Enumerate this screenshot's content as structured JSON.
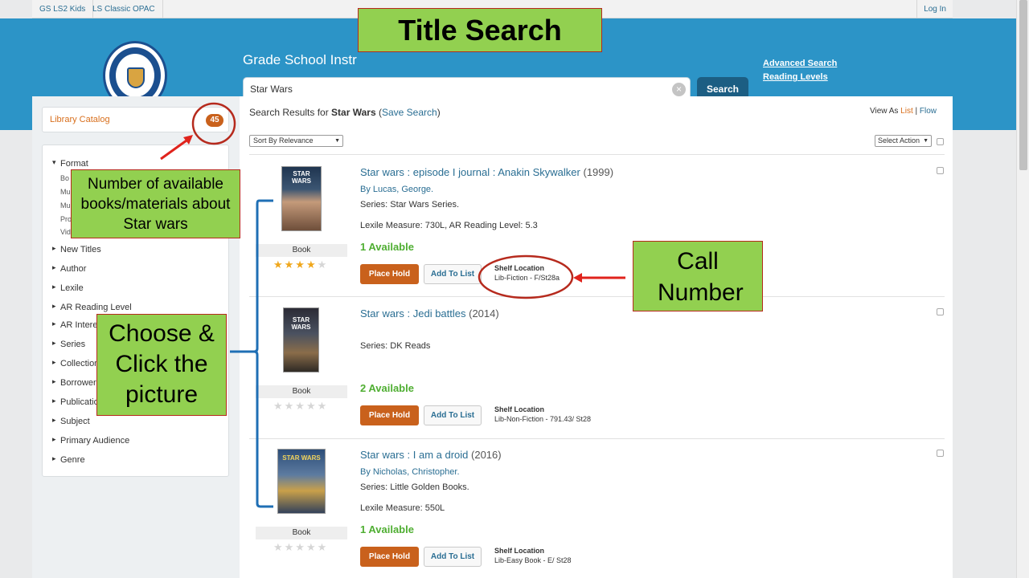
{
  "topbar": {
    "links": [
      "GS LS2 Kids",
      "LS Classic OPAC"
    ],
    "login": "Log In"
  },
  "header": {
    "site_title": "Grade School Instr",
    "search_value": "Star Wars",
    "search_button": "Search",
    "advanced_search": "Advanced Search",
    "reading_levels": "Reading Levels"
  },
  "sidebar": {
    "catalog_label": "Library Catalog",
    "catalog_count": "45",
    "format": "Format",
    "format_items": [
      "Bo",
      "Mu",
      "Mu",
      "Pro",
      "Vid"
    ],
    "facets": [
      "New Titles",
      "Author",
      "Lexile",
      "AR Reading Level",
      "AR Intere",
      "Series",
      "Collection",
      "Borrower",
      "Publication",
      "Subject",
      "Primary Audience",
      "Genre"
    ]
  },
  "results_header": {
    "prefix": "Search Results for ",
    "query": "Star Wars",
    "save_search": "Save Search",
    "view_as": "View As",
    "view_list": "List",
    "view_flow": "Flow",
    "sort": "Sort By Relevance",
    "action": "Select Action"
  },
  "results": [
    {
      "title": "Star wars : episode I journal : Anakin Skywalker",
      "year": "(1999)",
      "author": "By Lucas, George.",
      "series": "Series: Star Wars Series.",
      "lexile": "Lexile Measure: 730L, AR Reading Level: 5.3",
      "format": "Book",
      "rating": 4,
      "availability": "1 Available",
      "hold_label": "Place Hold",
      "list_label": "Add To List",
      "shelf_heading": "Shelf Location",
      "shelf_value": "Lib-Fiction - F/St28a"
    },
    {
      "title": "Star wars : Jedi battles",
      "year": "(2014)",
      "author": "",
      "series": "Series: DK Reads",
      "lexile": "",
      "format": "Book",
      "rating": 0,
      "availability": "2 Available",
      "hold_label": "Place Hold",
      "list_label": "Add To List",
      "shelf_heading": "Shelf Location",
      "shelf_value": "Lib-Non-Fiction - 791.43/ St28"
    },
    {
      "title": "Star wars : I am a droid",
      "year": "(2016)",
      "author": "By Nicholas, Christopher.",
      "series": "Series: Little Golden Books.",
      "lexile": "Lexile Measure: 550L",
      "format": "Book",
      "rating": 0,
      "availability": "1 Available",
      "hold_label": "Place Hold",
      "list_label": "Add To List",
      "shelf_heading": "Shelf Location",
      "shelf_value": "Lib-Easy Book - E/ St28"
    }
  ],
  "annotations": {
    "title_search": "Title Search",
    "count_note": "Number of available books/materials about Star wars",
    "choose_note": "Choose & Click the picture",
    "call_number": "Call Number"
  },
  "colors": {
    "header_blue": "#2c94c7",
    "accent_orange": "#c9611c",
    "available_green": "#4fae32",
    "callout_green": "#92d050",
    "annotation_red": "#b62a1d",
    "bracket_blue": "#1f6fb5"
  }
}
